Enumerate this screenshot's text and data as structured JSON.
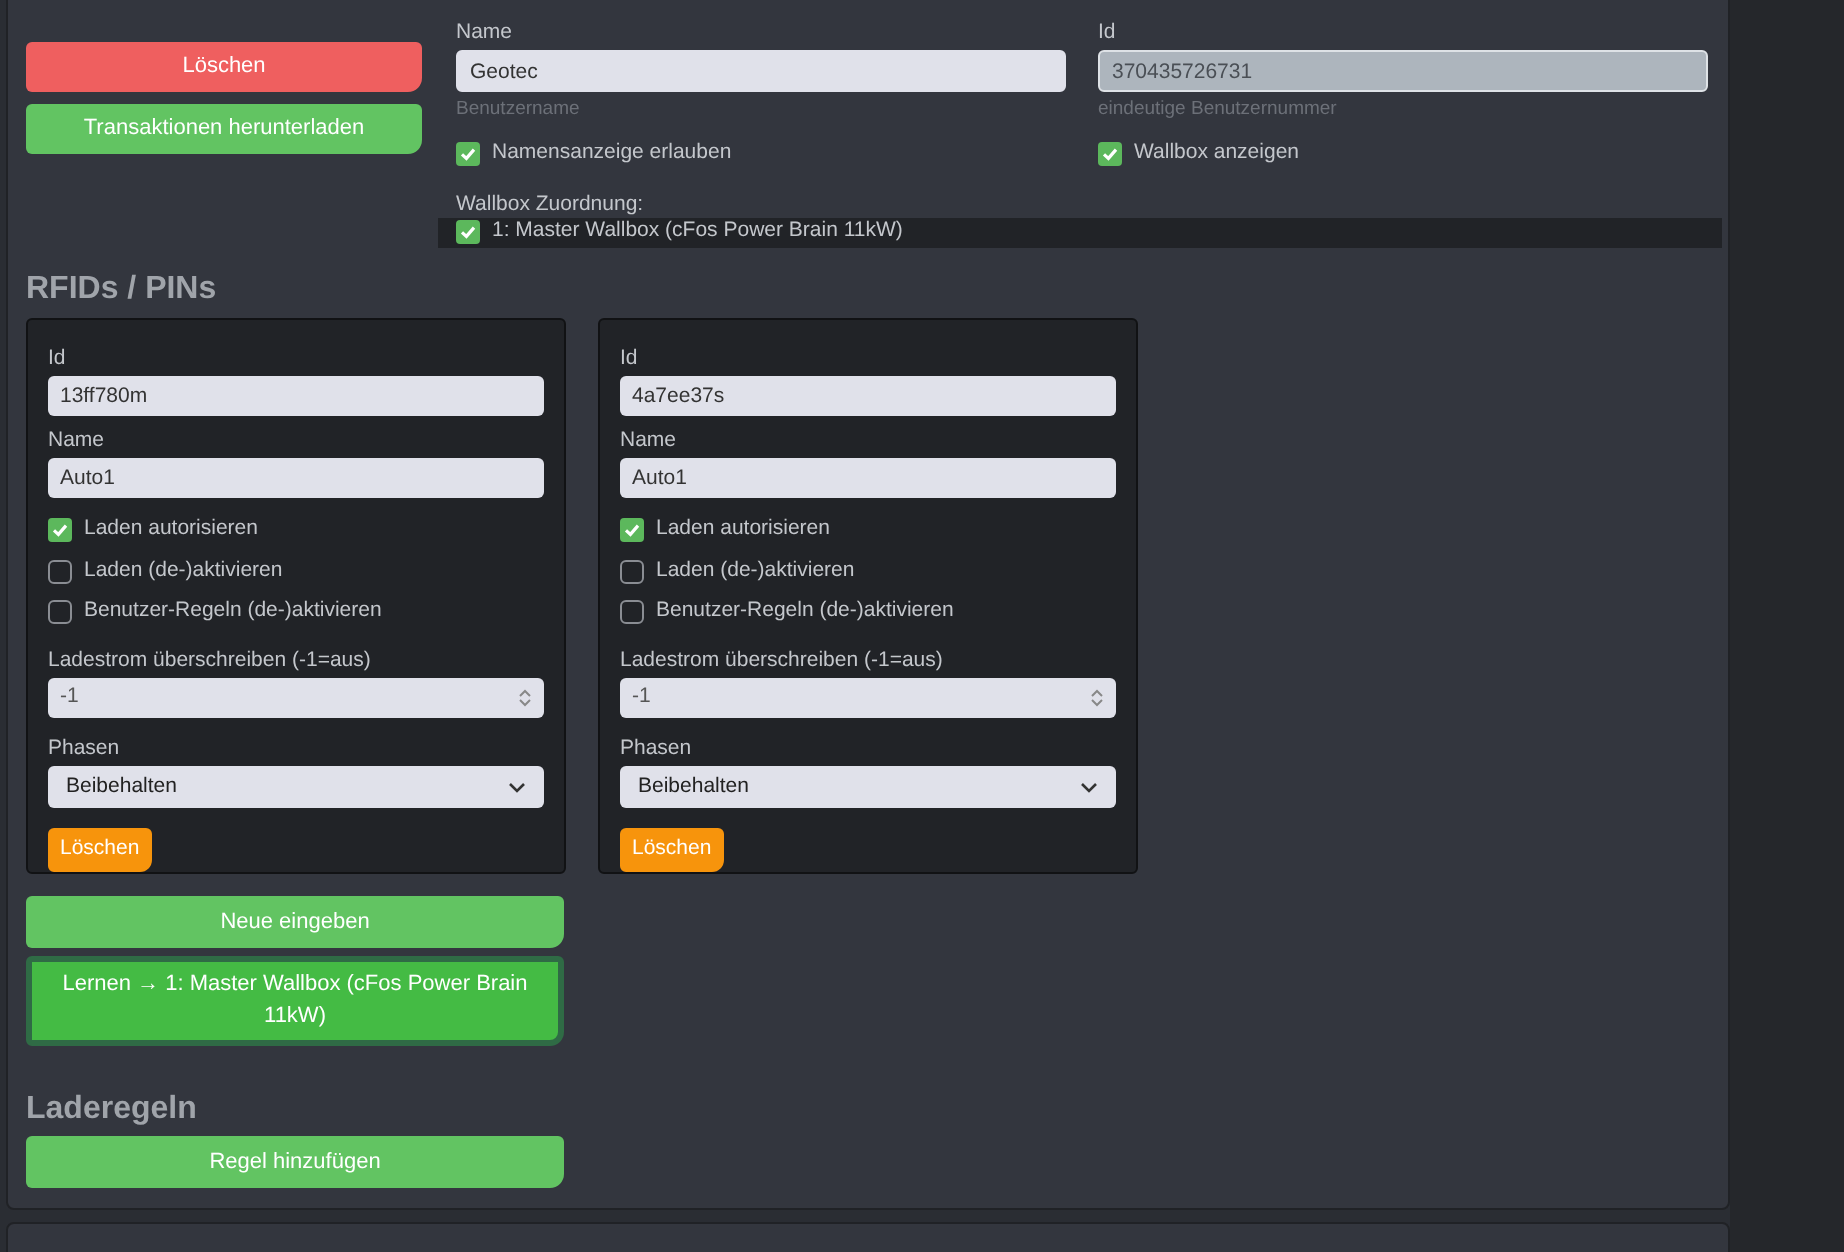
{
  "actions": [
    {
      "label": "Löschen",
      "kind": "danger"
    },
    {
      "label": "Transaktionen herunterladen",
      "kind": "success"
    }
  ],
  "user_fields": [
    {
      "label": "Name",
      "value": "Geotec",
      "hint": "Benutzername",
      "disabled": false,
      "checkbox": {
        "label": "Namensanzeige erlauben",
        "checked": true
      }
    },
    {
      "label": "Id",
      "value": "370435726731",
      "hint": "eindeutige Benutzernummer",
      "disabled": true,
      "checkbox": {
        "label": "Wallbox anzeigen",
        "checked": true
      }
    }
  ],
  "wallbox_assignment": {
    "label": "Wallbox Zuordnung:",
    "items": [
      {
        "label": "1: Master Wallbox (cFos Power Brain 11kW)",
        "checked": true
      }
    ]
  },
  "rfids": {
    "title": "RFIDs / PINs",
    "cards": [
      {
        "id_label": "Id",
        "id": "13ff780m",
        "name_label": "Name",
        "name": "Auto1",
        "options": [
          {
            "label": "Laden autorisieren",
            "checked": true
          },
          {
            "label": "Laden (de-)aktivieren",
            "checked": false
          },
          {
            "label": "Benutzer-Regeln (de-)aktivieren",
            "checked": false
          }
        ],
        "current_label": "Ladestrom überschreiben (-1=aus)",
        "current": "-1",
        "phases_label": "Phasen",
        "phases": "Beibehalten",
        "delete_label": "Löschen"
      },
      {
        "id_label": "Id",
        "id": "4a7ee37s",
        "name_label": "Name",
        "name": "Auto1",
        "options": [
          {
            "label": "Laden autorisieren",
            "checked": true
          },
          {
            "label": "Laden (de-)aktivieren",
            "checked": false
          },
          {
            "label": "Benutzer-Regeln (de-)aktivieren",
            "checked": false
          }
        ],
        "current_label": "Ladestrom überschreiben (-1=aus)",
        "current": "-1",
        "phases_label": "Phasen",
        "phases": "Beibehalten",
        "delete_label": "Löschen"
      }
    ],
    "buttons": [
      {
        "label": "Neue eingeben",
        "kind": "normal"
      },
      {
        "label": "Lernen → 1: Master Wallbox (cFos Power Brain 11kW)",
        "kind": "focused"
      }
    ]
  },
  "charging_rules": {
    "title": "Laderegeln",
    "button": "Regel hinzufügen"
  }
}
